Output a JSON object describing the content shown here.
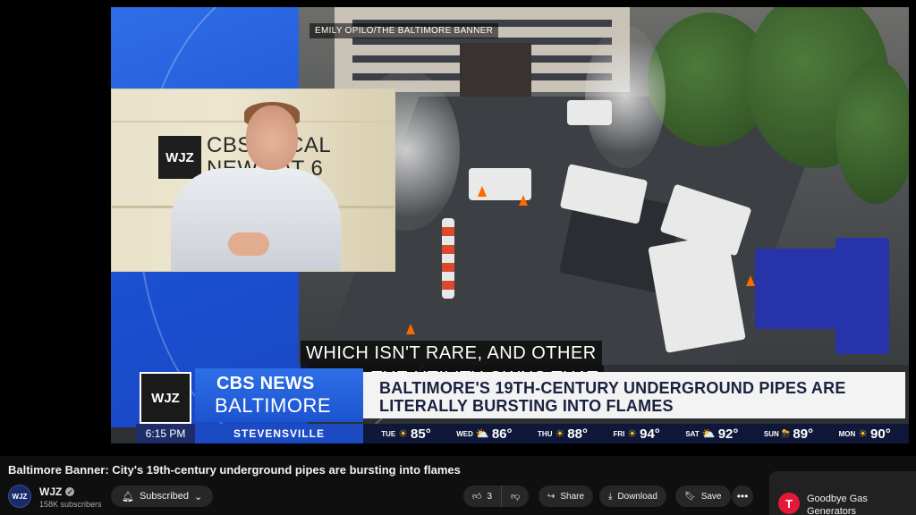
{
  "video": {
    "photo_credit": "EMILY OPILO/THE BALTIMORE BANNER",
    "studio_logo": "WJZ",
    "studio_text": "CBS LOCAL\nNEWS AT 6",
    "captions": [
      "WHICH ISN'T RARE, AND OTHER",
      "CITIES THE UTILITY OWNS THAT"
    ],
    "lower_third": {
      "logo": "WJZ",
      "brand": "CBS NEWS",
      "city": "BALTIMORE",
      "headline": "Baltimore's 19th-century underground pipes are literally bursting into flames"
    },
    "ticker": {
      "time": "6:15 PM",
      "location": "STEVENSVILLE",
      "forecast": [
        {
          "day": "TUE",
          "icon": "sun-icon",
          "temp": "85°"
        },
        {
          "day": "WED",
          "icon": "partly-cloudy-icon",
          "temp": "86°"
        },
        {
          "day": "THU",
          "icon": "sun-icon",
          "temp": "88°"
        },
        {
          "day": "FRI",
          "icon": "sun-icon",
          "temp": "94°"
        },
        {
          "day": "SAT",
          "icon": "partly-cloudy-icon",
          "temp": "92°"
        },
        {
          "day": "SUN",
          "icon": "storm-icon",
          "temp": "89°"
        },
        {
          "day": "MON",
          "icon": "sun-icon",
          "temp": "90°"
        }
      ]
    }
  },
  "title": "Baltimore Banner: City's 19th-century underground pipes are bursting into flames",
  "channel": {
    "avatar_text": "WJZ",
    "name": "WJZ",
    "subscribers": "158K subscribers",
    "subscribe_label": "Subscribed"
  },
  "actions": {
    "like_count": "3",
    "share_label": "Share",
    "download_label": "Download",
    "save_label": "Save"
  },
  "ad": {
    "logo": "T",
    "text": "Goodbye Gas Generators"
  },
  "colors": {
    "background": "#0f0f0f",
    "pill": "#272727",
    "cbs_blue": "#1c54cf",
    "ad_red": "#e31937"
  }
}
